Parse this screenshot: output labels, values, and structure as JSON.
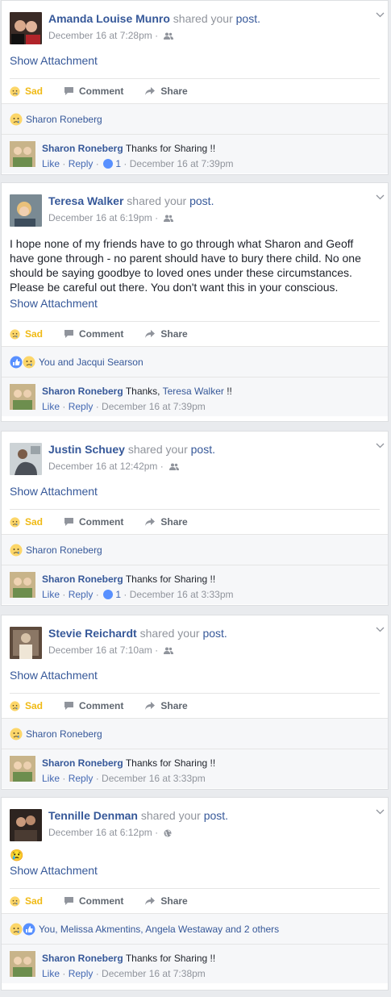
{
  "shared_text": "shared your",
  "post_word": "post.",
  "attachment_label": "Show Attachment",
  "action_labels": {
    "sad": "Sad",
    "comment": "Comment",
    "share": "Share"
  },
  "comment_action_labels": {
    "like": "Like",
    "reply": "Reply"
  },
  "colors": {
    "link": "#365899",
    "sad": "#f0ba15",
    "meta": "#90949c",
    "background": "#e9ebee"
  },
  "posts": [
    {
      "author": "Amanda Louise Munro",
      "timestamp": "December 16 at 7:28pm",
      "privacy_icon": "friends-icon",
      "body": "",
      "reactions": "Sharon Roneberg",
      "comment": {
        "author": "Sharon Roneberg",
        "pre": "Thanks for Sharing !!",
        "tag": "",
        "post": "",
        "likes": "1",
        "time": "December 16 at 7:39pm"
      }
    },
    {
      "author": "Teresa Walker",
      "timestamp": "December 16 at 6:19pm",
      "privacy_icon": "friends-icon",
      "body": "I hope none of my friends have to go through what Sharon and Geoff have gone through - no parent should have to bury there child. No one should be saying goodbye to loved ones under these circumstances. Please be careful out there. You don't want this in your conscious.",
      "reactions": "You and Jacqui Searson",
      "comment": {
        "author": "Sharon Roneberg",
        "pre": "Thanks,",
        "tag": "Teresa Walker",
        "post": "!!",
        "likes": "",
        "time": "December 16 at 7:39pm"
      }
    },
    {
      "author": "Justin Schuey",
      "timestamp": "December 16 at 12:42pm",
      "privacy_icon": "friends-icon",
      "body": "",
      "reactions": "Sharon Roneberg",
      "comment": {
        "author": "Sharon Roneberg",
        "pre": "Thanks for Sharing !!",
        "tag": "",
        "post": "",
        "likes": "1",
        "time": "December 16 at 3:33pm"
      }
    },
    {
      "author": "Stevie Reichardt",
      "timestamp": "December 16 at 7:10am",
      "privacy_icon": "friends-icon",
      "body": "",
      "reactions": "Sharon Roneberg",
      "comment": {
        "author": "Sharon Roneberg",
        "pre": "Thanks for Sharing !!",
        "tag": "",
        "post": "",
        "likes": "",
        "time": "December 16 at 3:33pm"
      }
    },
    {
      "author": "Tennille Denman",
      "timestamp": "December 16 at 6:12pm",
      "privacy_icon": "globe-icon",
      "body": "😢",
      "reactions": "You, Melissa Akmentins, Angela Westaway and 2 others",
      "comment": {
        "author": "Sharon Roneberg",
        "pre": "Thanks for Sharing !!",
        "tag": "",
        "post": "",
        "likes": "",
        "time": "December 16 at 7:38pm"
      }
    }
  ]
}
